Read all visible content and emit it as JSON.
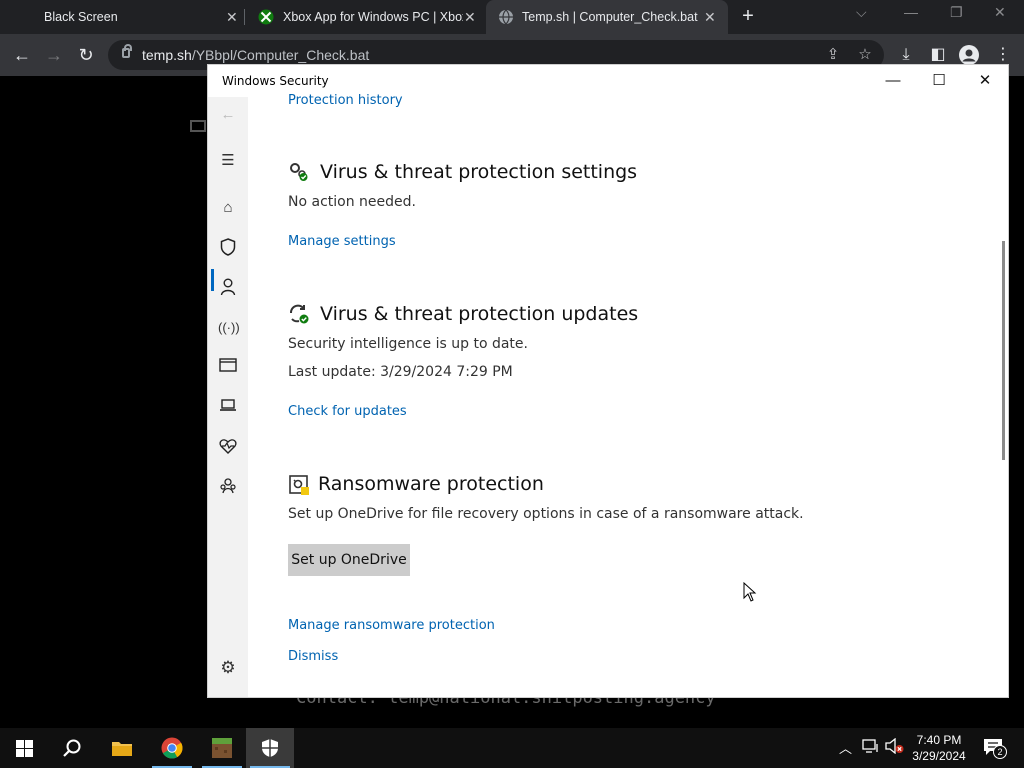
{
  "browser": {
    "tabs": [
      {
        "title": "Black Screen",
        "active": false
      },
      {
        "title": "Xbox App for Windows PC | Xbox",
        "active": false,
        "icon": "xbox-icon"
      },
      {
        "title": "Temp.sh | Computer_Check.bat",
        "active": true,
        "icon": "globe-icon"
      }
    ],
    "url_host": "temp.sh",
    "url_path": "/YBbpl/Computer_Check.bat"
  },
  "background_page": {
    "text": "Contact: temp@national.shitposting.agency"
  },
  "window": {
    "title": "Windows Security",
    "protection_history": "Protection history",
    "sections": [
      {
        "icon": "gear-check-icon",
        "heading": "Virus & threat protection settings",
        "lines": [
          "No action needed."
        ],
        "link": "Manage settings"
      },
      {
        "icon": "refresh-check-icon",
        "heading": "Virus & threat protection updates",
        "lines": [
          "Security intelligence is up to date.",
          "Last update: 3/29/2024 7:29 PM"
        ],
        "link": "Check for updates"
      },
      {
        "icon": "ransomware-icon",
        "heading": "Ransomware protection",
        "lines": [
          "Set up OneDrive for file recovery options in case of a ransomware attack."
        ],
        "button": "Set up OneDrive",
        "links": [
          "Manage ransomware protection",
          "Dismiss"
        ]
      }
    ]
  },
  "taskbar": {
    "time": "7:40 PM",
    "date": "3/29/2024",
    "notification_count": "2"
  },
  "colors": {
    "link": "#0063b1",
    "accent": "#0067c0"
  }
}
